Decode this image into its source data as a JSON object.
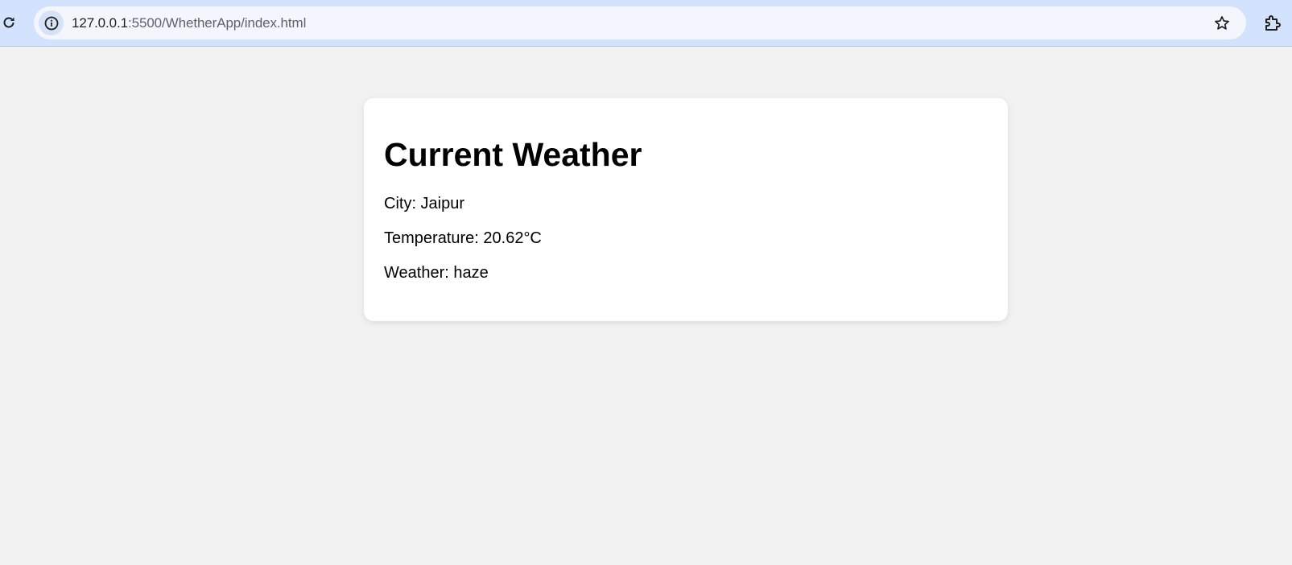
{
  "browser": {
    "url_host": "127.0.0.1",
    "url_rest": ":5500/WhetherApp/index.html",
    "icons": {
      "reload": "reload-icon",
      "site_info": "info-icon",
      "bookmark": "star-icon",
      "extensions": "puzzle-icon"
    }
  },
  "weather": {
    "title": "Current Weather",
    "city_line": "City: Jaipur",
    "temperature_line": "Temperature: 20.62°C",
    "condition_line": "Weather: haze"
  },
  "colors": {
    "toolbar_bg": "#d3e3fd",
    "omnibox_bg": "#f3f6fc",
    "page_bg": "#f2f2f2",
    "card_bg": "#ffffff"
  }
}
